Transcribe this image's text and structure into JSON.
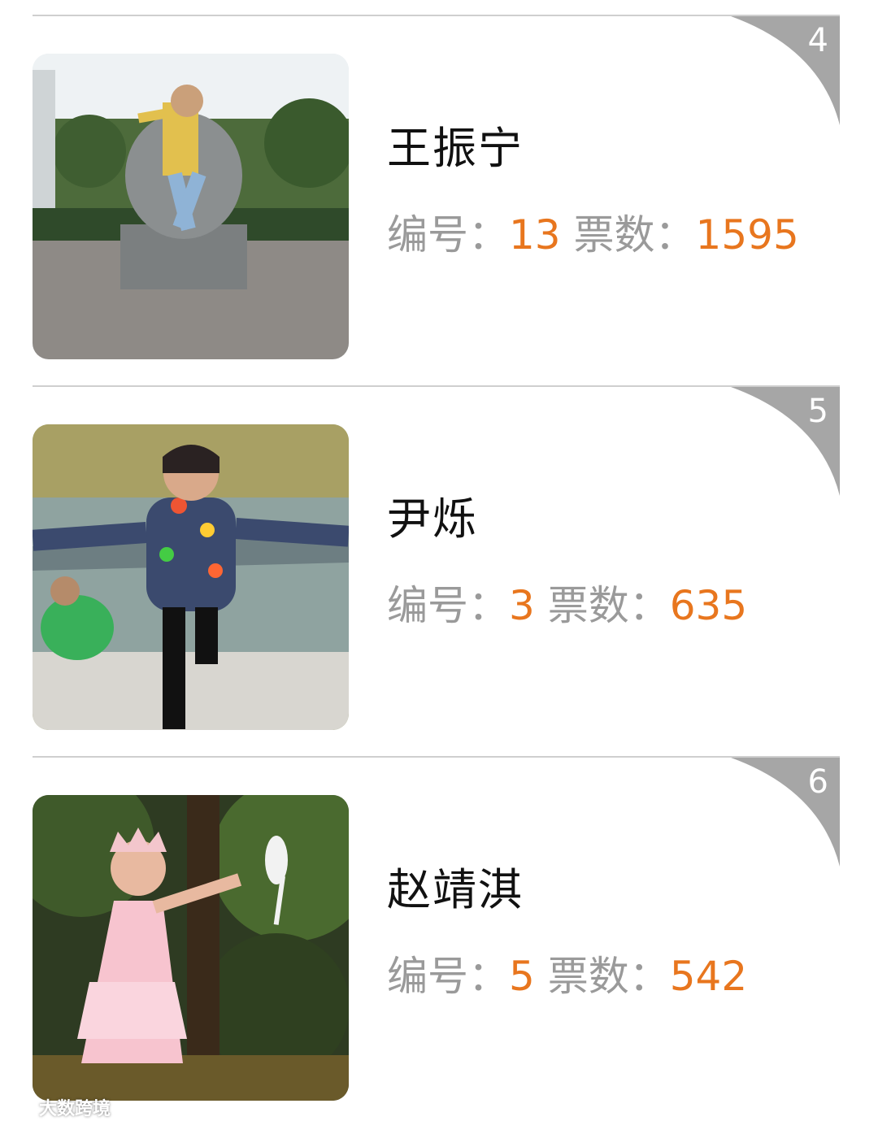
{
  "labels": {
    "id_label": "编号：",
    "votes_label": "票数："
  },
  "colors": {
    "accent": "#e8761e",
    "label_gray": "#9a9a9a",
    "corner_gray": "#a6a6a6"
  },
  "entries": [
    {
      "rank": "4",
      "name": "王振宁",
      "id": "13",
      "votes": "1595"
    },
    {
      "rank": "5",
      "name": "尹烁",
      "id": "3",
      "votes": "635"
    },
    {
      "rank": "6",
      "name": "赵靖淇",
      "id": "5",
      "votes": "542"
    }
  ],
  "watermark": "大数跨境"
}
